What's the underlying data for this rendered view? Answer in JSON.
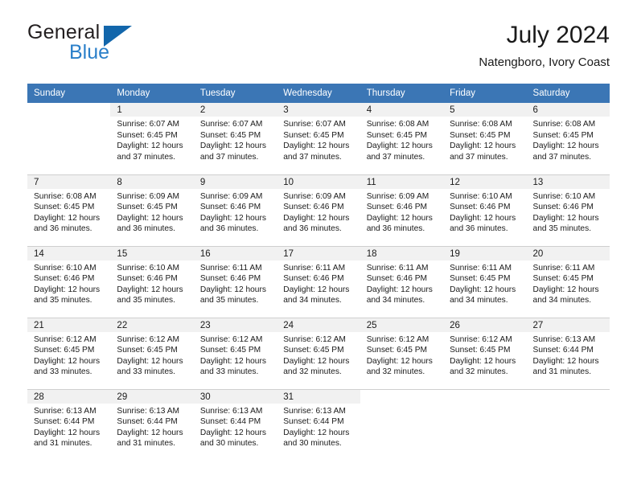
{
  "brand": {
    "name_part1": "General",
    "name_part2": "Blue",
    "flag_color": "#1266ab"
  },
  "header": {
    "title": "July 2024",
    "subtitle": "Natengboro, Ivory Coast",
    "header_bg": "#3b76b5",
    "daynum_bg": "#f1f1f1"
  },
  "weekdays": [
    "Sunday",
    "Monday",
    "Tuesday",
    "Wednesday",
    "Thursday",
    "Friday",
    "Saturday"
  ],
  "weeks": [
    [
      {
        "day": "",
        "sunrise": "",
        "sunset": "",
        "daylight1": "",
        "daylight2": "",
        "blank": true
      },
      {
        "day": "1",
        "sunrise": "Sunrise: 6:07 AM",
        "sunset": "Sunset: 6:45 PM",
        "daylight1": "Daylight: 12 hours",
        "daylight2": "and 37 minutes."
      },
      {
        "day": "2",
        "sunrise": "Sunrise: 6:07 AM",
        "sunset": "Sunset: 6:45 PM",
        "daylight1": "Daylight: 12 hours",
        "daylight2": "and 37 minutes."
      },
      {
        "day": "3",
        "sunrise": "Sunrise: 6:07 AM",
        "sunset": "Sunset: 6:45 PM",
        "daylight1": "Daylight: 12 hours",
        "daylight2": "and 37 minutes."
      },
      {
        "day": "4",
        "sunrise": "Sunrise: 6:08 AM",
        "sunset": "Sunset: 6:45 PM",
        "daylight1": "Daylight: 12 hours",
        "daylight2": "and 37 minutes."
      },
      {
        "day": "5",
        "sunrise": "Sunrise: 6:08 AM",
        "sunset": "Sunset: 6:45 PM",
        "daylight1": "Daylight: 12 hours",
        "daylight2": "and 37 minutes."
      },
      {
        "day": "6",
        "sunrise": "Sunrise: 6:08 AM",
        "sunset": "Sunset: 6:45 PM",
        "daylight1": "Daylight: 12 hours",
        "daylight2": "and 37 minutes."
      }
    ],
    [
      {
        "day": "7",
        "sunrise": "Sunrise: 6:08 AM",
        "sunset": "Sunset: 6:45 PM",
        "daylight1": "Daylight: 12 hours",
        "daylight2": "and 36 minutes."
      },
      {
        "day": "8",
        "sunrise": "Sunrise: 6:09 AM",
        "sunset": "Sunset: 6:45 PM",
        "daylight1": "Daylight: 12 hours",
        "daylight2": "and 36 minutes."
      },
      {
        "day": "9",
        "sunrise": "Sunrise: 6:09 AM",
        "sunset": "Sunset: 6:46 PM",
        "daylight1": "Daylight: 12 hours",
        "daylight2": "and 36 minutes."
      },
      {
        "day": "10",
        "sunrise": "Sunrise: 6:09 AM",
        "sunset": "Sunset: 6:46 PM",
        "daylight1": "Daylight: 12 hours",
        "daylight2": "and 36 minutes."
      },
      {
        "day": "11",
        "sunrise": "Sunrise: 6:09 AM",
        "sunset": "Sunset: 6:46 PM",
        "daylight1": "Daylight: 12 hours",
        "daylight2": "and 36 minutes."
      },
      {
        "day": "12",
        "sunrise": "Sunrise: 6:10 AM",
        "sunset": "Sunset: 6:46 PM",
        "daylight1": "Daylight: 12 hours",
        "daylight2": "and 36 minutes."
      },
      {
        "day": "13",
        "sunrise": "Sunrise: 6:10 AM",
        "sunset": "Sunset: 6:46 PM",
        "daylight1": "Daylight: 12 hours",
        "daylight2": "and 35 minutes."
      }
    ],
    [
      {
        "day": "14",
        "sunrise": "Sunrise: 6:10 AM",
        "sunset": "Sunset: 6:46 PM",
        "daylight1": "Daylight: 12 hours",
        "daylight2": "and 35 minutes."
      },
      {
        "day": "15",
        "sunrise": "Sunrise: 6:10 AM",
        "sunset": "Sunset: 6:46 PM",
        "daylight1": "Daylight: 12 hours",
        "daylight2": "and 35 minutes."
      },
      {
        "day": "16",
        "sunrise": "Sunrise: 6:11 AM",
        "sunset": "Sunset: 6:46 PM",
        "daylight1": "Daylight: 12 hours",
        "daylight2": "and 35 minutes."
      },
      {
        "day": "17",
        "sunrise": "Sunrise: 6:11 AM",
        "sunset": "Sunset: 6:46 PM",
        "daylight1": "Daylight: 12 hours",
        "daylight2": "and 34 minutes."
      },
      {
        "day": "18",
        "sunrise": "Sunrise: 6:11 AM",
        "sunset": "Sunset: 6:46 PM",
        "daylight1": "Daylight: 12 hours",
        "daylight2": "and 34 minutes."
      },
      {
        "day": "19",
        "sunrise": "Sunrise: 6:11 AM",
        "sunset": "Sunset: 6:45 PM",
        "daylight1": "Daylight: 12 hours",
        "daylight2": "and 34 minutes."
      },
      {
        "day": "20",
        "sunrise": "Sunrise: 6:11 AM",
        "sunset": "Sunset: 6:45 PM",
        "daylight1": "Daylight: 12 hours",
        "daylight2": "and 34 minutes."
      }
    ],
    [
      {
        "day": "21",
        "sunrise": "Sunrise: 6:12 AM",
        "sunset": "Sunset: 6:45 PM",
        "daylight1": "Daylight: 12 hours",
        "daylight2": "and 33 minutes."
      },
      {
        "day": "22",
        "sunrise": "Sunrise: 6:12 AM",
        "sunset": "Sunset: 6:45 PM",
        "daylight1": "Daylight: 12 hours",
        "daylight2": "and 33 minutes."
      },
      {
        "day": "23",
        "sunrise": "Sunrise: 6:12 AM",
        "sunset": "Sunset: 6:45 PM",
        "daylight1": "Daylight: 12 hours",
        "daylight2": "and 33 minutes."
      },
      {
        "day": "24",
        "sunrise": "Sunrise: 6:12 AM",
        "sunset": "Sunset: 6:45 PM",
        "daylight1": "Daylight: 12 hours",
        "daylight2": "and 32 minutes."
      },
      {
        "day": "25",
        "sunrise": "Sunrise: 6:12 AM",
        "sunset": "Sunset: 6:45 PM",
        "daylight1": "Daylight: 12 hours",
        "daylight2": "and 32 minutes."
      },
      {
        "day": "26",
        "sunrise": "Sunrise: 6:12 AM",
        "sunset": "Sunset: 6:45 PM",
        "daylight1": "Daylight: 12 hours",
        "daylight2": "and 32 minutes."
      },
      {
        "day": "27",
        "sunrise": "Sunrise: 6:13 AM",
        "sunset": "Sunset: 6:44 PM",
        "daylight1": "Daylight: 12 hours",
        "daylight2": "and 31 minutes."
      }
    ],
    [
      {
        "day": "28",
        "sunrise": "Sunrise: 6:13 AM",
        "sunset": "Sunset: 6:44 PM",
        "daylight1": "Daylight: 12 hours",
        "daylight2": "and 31 minutes."
      },
      {
        "day": "29",
        "sunrise": "Sunrise: 6:13 AM",
        "sunset": "Sunset: 6:44 PM",
        "daylight1": "Daylight: 12 hours",
        "daylight2": "and 31 minutes."
      },
      {
        "day": "30",
        "sunrise": "Sunrise: 6:13 AM",
        "sunset": "Sunset: 6:44 PM",
        "daylight1": "Daylight: 12 hours",
        "daylight2": "and 30 minutes."
      },
      {
        "day": "31",
        "sunrise": "Sunrise: 6:13 AM",
        "sunset": "Sunset: 6:44 PM",
        "daylight1": "Daylight: 12 hours",
        "daylight2": "and 30 minutes."
      },
      {
        "day": "",
        "sunrise": "",
        "sunset": "",
        "daylight1": "",
        "daylight2": "",
        "blank": true
      },
      {
        "day": "",
        "sunrise": "",
        "sunset": "",
        "daylight1": "",
        "daylight2": "",
        "blank": true
      },
      {
        "day": "",
        "sunrise": "",
        "sunset": "",
        "daylight1": "",
        "daylight2": "",
        "blank": true
      }
    ]
  ]
}
